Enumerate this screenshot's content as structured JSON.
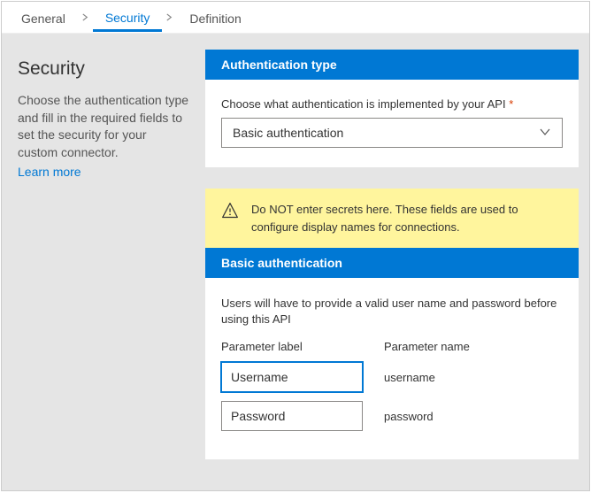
{
  "tabs": {
    "general": "General",
    "security": "Security",
    "definition": "Definition"
  },
  "sidebar": {
    "title": "Security",
    "description": "Choose the authentication type and fill in the required fields to set the security for your custom connector.",
    "learn_more": "Learn more"
  },
  "auth_type": {
    "header": "Authentication type",
    "label": "Choose what authentication is implemented by your API",
    "selected": "Basic authentication"
  },
  "warning": "Do NOT enter secrets here. These fields are used to configure display names for connections.",
  "basic_auth": {
    "header": "Basic authentication",
    "description": "Users will have to provide a valid user name and password before using this API",
    "col_label": "Parameter label",
    "col_name": "Parameter name",
    "rows": [
      {
        "label": "Username",
        "name": "username"
      },
      {
        "label": "Password",
        "name": "password"
      }
    ]
  }
}
